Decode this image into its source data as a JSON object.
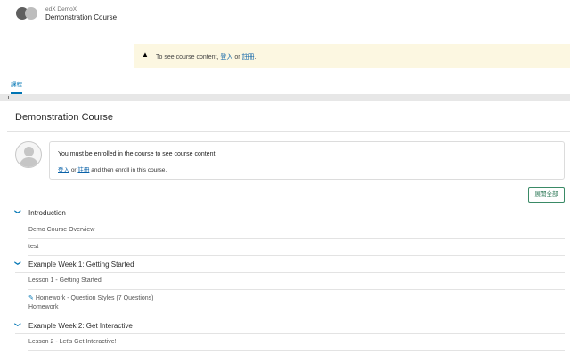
{
  "header": {
    "org": "edX DemoX",
    "title": "Demonstration Course"
  },
  "alert": {
    "icon": "warning-icon",
    "text_prefix": "To see course content,",
    "signin_label": "登入",
    "or": "or",
    "register_label": "註冊",
    "suffix": "."
  },
  "tabs": [
    {
      "label": "課程",
      "active": true
    }
  ],
  "main": {
    "title": "Demonstration Course",
    "notice": {
      "line1": "You must be enrolled in the course to see course content.",
      "signin_label": "登入",
      "or": "or",
      "register_label": "註冊",
      "line2_suffix": "and then enroll in this course."
    },
    "expand_all_label": "展開全部"
  },
  "outline": [
    {
      "title": "Introduction",
      "items": [
        {
          "label": "Demo Course Overview"
        },
        {
          "label": "test"
        }
      ]
    },
    {
      "title": "Example Week 1: Getting Started",
      "items": [
        {
          "label": "Lesson 1 - Getting Started"
        },
        {
          "label": "Homework - Question Styles (7 Questions)",
          "sublabel": "Homework",
          "icon": "edit-icon"
        }
      ]
    },
    {
      "title": "Example Week 2: Get Interactive",
      "items": [
        {
          "label": "Lesson 2 - Let's Get Interactive!"
        }
      ]
    }
  ],
  "colors": {
    "accent": "#0075b4",
    "alert_bg": "#fcf7e1",
    "button_border": "#3a8a66"
  }
}
